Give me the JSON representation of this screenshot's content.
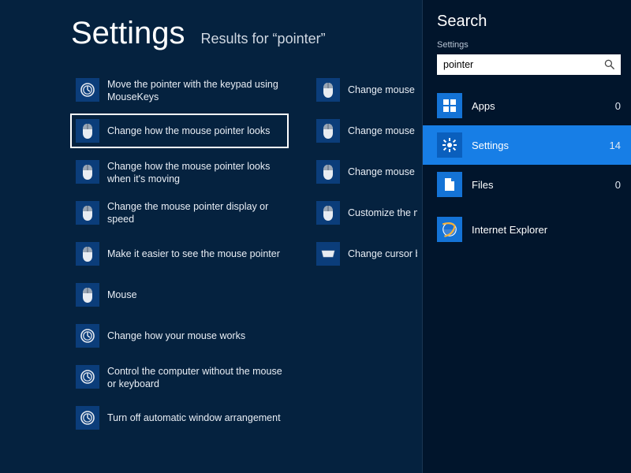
{
  "header": {
    "title": "Settings",
    "subtitle": "Results for “pointer”"
  },
  "results_col1": [
    {
      "icon": "clock",
      "label": "Move the pointer with the keypad using MouseKeys",
      "twoline": true
    },
    {
      "icon": "mouse",
      "label": "Change how the mouse pointer looks",
      "selected": true
    },
    {
      "icon": "mouse",
      "label": "Change how the mouse pointer looks when it's moving",
      "twoline": true
    },
    {
      "icon": "mouse",
      "label": "Change the mouse pointer display or speed"
    },
    {
      "icon": "mouse",
      "label": "Make it easier to see the mouse pointer"
    },
    {
      "icon": "mouse",
      "label": "Mouse"
    },
    {
      "icon": "clock",
      "label": "Change how your mouse works"
    },
    {
      "icon": "clock",
      "label": "Control the computer without the mouse or keyboard",
      "twoline": true
    },
    {
      "icon": "clock",
      "label": "Turn off automatic window arrangement"
    }
  ],
  "results_col2": [
    {
      "icon": "mouse",
      "label": "Change mouse setti"
    },
    {
      "icon": "mouse",
      "label": "Change mouse click"
    },
    {
      "icon": "mouse",
      "label": "Change mouse whe"
    },
    {
      "icon": "mouse",
      "label": "Customize the mou"
    },
    {
      "icon": "keyboard",
      "label": "Change cursor blink"
    }
  ],
  "search": {
    "title": "Search",
    "scope_label": "Settings",
    "query": "pointer",
    "filters": [
      {
        "key": "apps",
        "name": "Apps",
        "count": 0,
        "icon": "grid"
      },
      {
        "key": "settings",
        "name": "Settings",
        "count": 14,
        "icon": "gear",
        "active": true
      },
      {
        "key": "files",
        "name": "Files",
        "count": 0,
        "icon": "file"
      }
    ],
    "ie": {
      "name": "Internet Explorer"
    }
  }
}
